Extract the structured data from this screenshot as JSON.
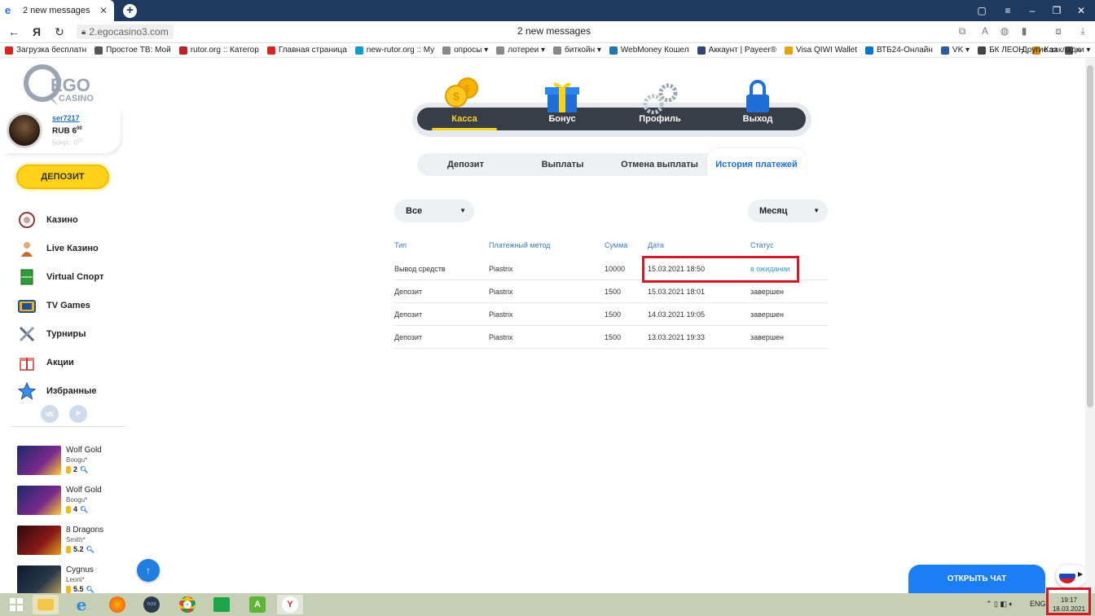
{
  "browser": {
    "tab_title": "2 new messages",
    "page_title": "2 new messages",
    "url": "2.egocasino3.com",
    "bookmarks": [
      "Загрузка бесплатн",
      "Простое ТВ: Мой",
      "rutor.org :: Категор",
      "Главная страница",
      "new-rutor.org :: My",
      "опросы ▾",
      "лотереи ▾",
      "биткойн ▾",
      "WebMoney Кошел",
      "Аккаунт | Payeer®",
      "Visa QIWI Wallet",
      "ВТБ24-Онлайн",
      "VK ▾",
      "БК ЛЕОН",
      "Каз",
      "»"
    ],
    "other_bookmarks": "Другие закладки ▾"
  },
  "user": {
    "name": "ser7217",
    "balance_main": "RUB 6",
    "balance_cents": "00",
    "bonus": "Бонус: 0",
    "bonus_cents": "00"
  },
  "sidebar": {
    "logo_text_top": "EGO",
    "logo_text_bottom": "CASINO",
    "deposit_label": "ДЕПОЗИТ",
    "nav": [
      {
        "label": "Казино",
        "icon": "casino-chip-icon"
      },
      {
        "label": "Live Казино",
        "icon": "dealer-icon"
      },
      {
        "label": "Virtual Спорт",
        "icon": "field-icon"
      },
      {
        "label": "TV Games",
        "icon": "tv-icon"
      },
      {
        "label": "Турниры",
        "icon": "swords-icon"
      },
      {
        "label": "Акции",
        "icon": "gift-icon"
      },
      {
        "label": "Избранные",
        "icon": "star-icon"
      }
    ],
    "social": {
      "vk": "vk",
      "tg": "➤"
    }
  },
  "recent_wins": [
    {
      "game": "Wolf Gold",
      "player": "Boogu*",
      "amount": "2"
    },
    {
      "game": "Wolf Gold",
      "player": "Boogu*",
      "amount": "4"
    },
    {
      "game": "8 Dragons",
      "player": "Smith*",
      "amount": "5.2"
    },
    {
      "game": "Cygnus",
      "player": "Leoni*",
      "amount": "5.5"
    }
  ],
  "main_menu": {
    "kassa": "Касса",
    "bonus": "Бонус",
    "profile": "Профиль",
    "exit": "Выход"
  },
  "sub_tabs": {
    "deposit": "Депозит",
    "payouts": "Выплаты",
    "cancel": "Отмена выплаты",
    "history": "История платежей"
  },
  "filters": {
    "type": "Все",
    "period": "Месяц"
  },
  "table": {
    "headers": [
      "Тип",
      "Платежный метод",
      "Сумма",
      "Дата",
      "Статус"
    ],
    "rows": [
      {
        "type": "Вывод средств",
        "method": "Piastrix",
        "amount": "10000",
        "date": "15.03.2021 18:50",
        "status": "в ожидании"
      },
      {
        "type": "Депозит",
        "method": "Piastrix",
        "amount": "1500",
        "date": "15.03.2021 18:01",
        "status": "завершен"
      },
      {
        "type": "Депозит",
        "method": "Piastrix",
        "amount": "1500",
        "date": "14.03.2021 19:05",
        "status": "завершен"
      },
      {
        "type": "Депозит",
        "method": "Piastrix",
        "amount": "1500",
        "date": "13.03.2021 19:33",
        "status": "завершен"
      }
    ]
  },
  "chat": {
    "label": "ОТКРЫТЬ ЧАТ"
  },
  "taskbar": {
    "lang": "ENG",
    "time": "19:17",
    "date": "18.03.2021"
  },
  "colors": {
    "accent_yellow": "#ffd21a",
    "menu_dark": "#383e47",
    "link_blue": "#3b7dc4",
    "pending_status": "#3b9fd4",
    "highlight_red": "#d01c2a",
    "chat_blue": "#1b7ef5"
  }
}
